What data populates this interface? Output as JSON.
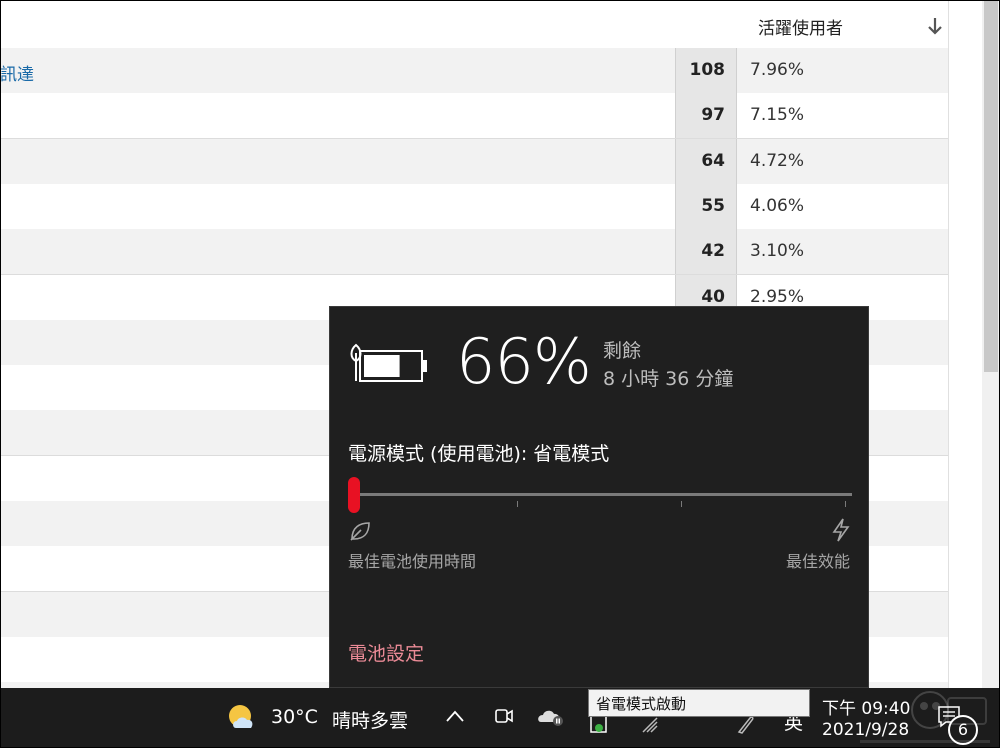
{
  "table": {
    "header_label": "活躍使用者",
    "rows": [
      {
        "link": "訊達",
        "count": "108",
        "pct": "7.96%"
      },
      {
        "link": "",
        "count": "97",
        "pct": "7.15%"
      },
      {
        "link": "",
        "count": "64",
        "pct": "4.72%"
      },
      {
        "link": "",
        "count": "55",
        "pct": "4.06%"
      },
      {
        "link": "",
        "count": "42",
        "pct": "3.10%"
      },
      {
        "link": "",
        "count": "40",
        "pct": "2.95%"
      },
      {
        "link": "",
        "count": "",
        "pct": ""
      },
      {
        "link": "",
        "count": "",
        "pct": ""
      },
      {
        "link": "",
        "count": "",
        "pct": ""
      },
      {
        "link": "",
        "count": "",
        "pct": ""
      },
      {
        "link": "",
        "count": "",
        "pct": ""
      },
      {
        "link": "",
        "count": "",
        "pct": ""
      },
      {
        "link": "",
        "count": "",
        "pct": ""
      },
      {
        "link": "",
        "count": "",
        "pct": ""
      },
      {
        "link": "",
        "count": "",
        "pct": ""
      }
    ]
  },
  "battery": {
    "percent": "66%",
    "remaining_label": "剩餘",
    "remaining_time": "8 小時 36 分鐘",
    "level": 0.66,
    "power_mode_label": "電源模式 (使用電池): 省電模式",
    "slider_position": 0,
    "slider_left_label": "最佳電池使用時間",
    "slider_right_label": "最佳效能",
    "settings_link": "電池設定",
    "accent_color": "#e81123"
  },
  "taskbar": {
    "weather_temp": "30°C",
    "weather_desc": "晴時多雲",
    "tooltip_text": "省電模式啟動",
    "ime_label": "英",
    "time": "下午 09:40",
    "date": "2021/9/28",
    "notification_count": "6"
  }
}
